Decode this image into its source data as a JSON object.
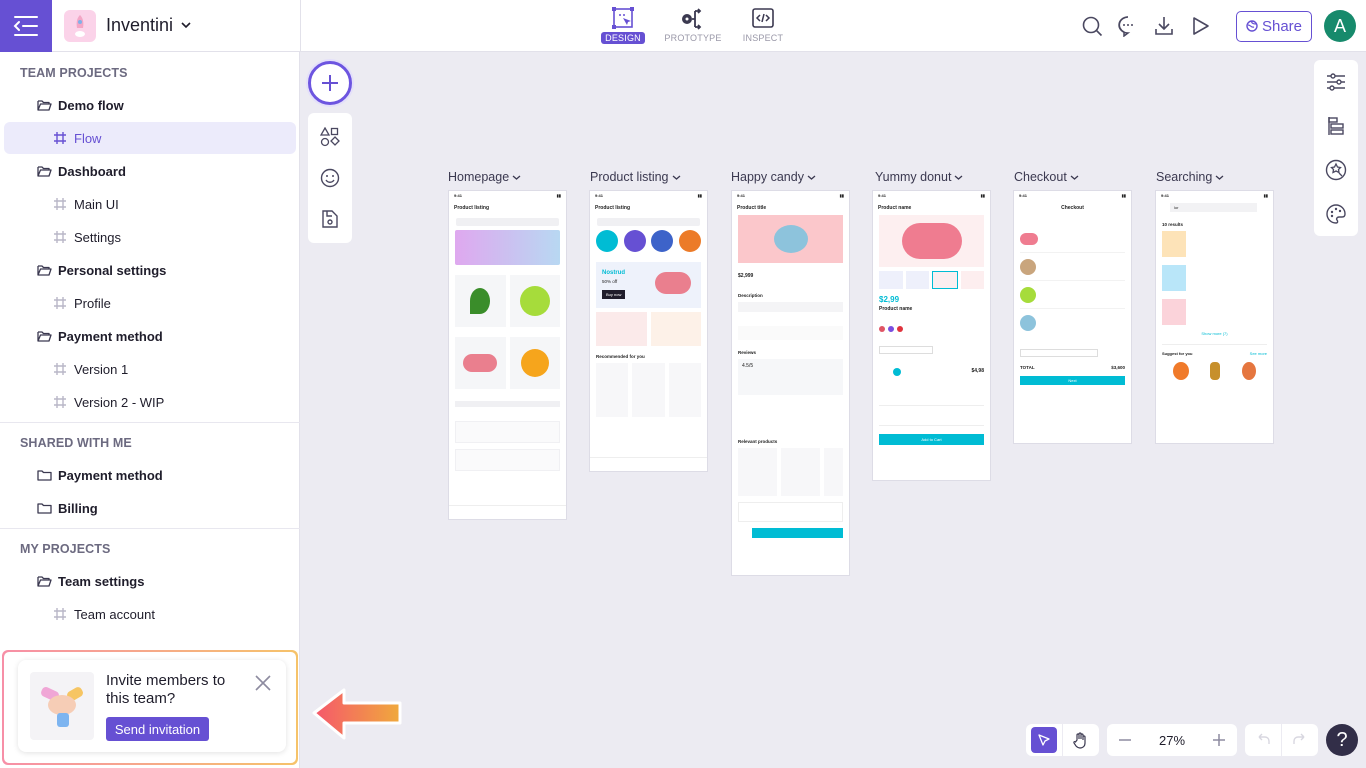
{
  "app": {
    "name": "Inventini"
  },
  "modes": [
    {
      "label": "DESIGN",
      "icon": "design-icon",
      "active": true
    },
    {
      "label": "PROTOTYPE",
      "icon": "prototype-icon",
      "active": false
    },
    {
      "label": "INSPECT",
      "icon": "inspect-icon",
      "active": false
    }
  ],
  "toolbar": {
    "share_label": "Share",
    "avatar_initial": "A"
  },
  "sidebar": {
    "sections": [
      {
        "title": "TEAM PROJECTS"
      },
      {
        "title": "SHARED WITH ME"
      },
      {
        "title": "MY PROJECTS"
      }
    ],
    "team_projects": [
      {
        "label": "Demo flow",
        "type": "folder-open"
      },
      {
        "label": "Flow",
        "type": "page",
        "active": true
      },
      {
        "label": "Dashboard",
        "type": "folder-open"
      },
      {
        "label": "Main UI",
        "type": "page"
      },
      {
        "label": "Settings",
        "type": "page"
      },
      {
        "label": "Personal settings",
        "type": "folder-open"
      },
      {
        "label": "Profile",
        "type": "page"
      },
      {
        "label": "Payment method",
        "type": "folder-open"
      },
      {
        "label": "Version 1",
        "type": "page"
      },
      {
        "label": "Version 2 - WIP",
        "type": "page"
      }
    ],
    "shared": [
      {
        "label": "Payment method",
        "type": "folder"
      },
      {
        "label": "Billing",
        "type": "folder"
      }
    ],
    "my_projects": [
      {
        "label": "Team settings",
        "type": "folder-open"
      },
      {
        "label": "Team account",
        "type": "page"
      }
    ]
  },
  "invite": {
    "text": "Invite members to this team?",
    "button": "Send invitation"
  },
  "frames": [
    {
      "label": "Homepage",
      "header": "Product listing"
    },
    {
      "label": "Product listing",
      "header": "Product listing",
      "promo_title": "Nostrud",
      "promo_sub": "50% off",
      "promo_btn": "Buy now",
      "section": "Recommended for you"
    },
    {
      "label": "Happy candy",
      "header": "Product title",
      "price": "$2,999",
      "rating": "4.5/5",
      "section1": "Description",
      "section2": "Reviews",
      "section3": "Relevant products"
    },
    {
      "label": "Yummy donut",
      "header": "Product name",
      "price": "$2,99",
      "name": "Product name",
      "total": "$4,98",
      "cta": "Add to Cart"
    },
    {
      "label": "Checkout",
      "header": "Checkout",
      "total_label": "TOTAL",
      "total": "$3,600",
      "cta": "Next"
    },
    {
      "label": "Searching",
      "query": "lor",
      "results": "10 results",
      "more": "Show more (7)",
      "suggest": "Suggest for you",
      "see_more": "See more"
    }
  ],
  "zoom": {
    "level": "27%"
  },
  "colors": {
    "accent": "#6650d3",
    "teal": "#00bcd4"
  }
}
